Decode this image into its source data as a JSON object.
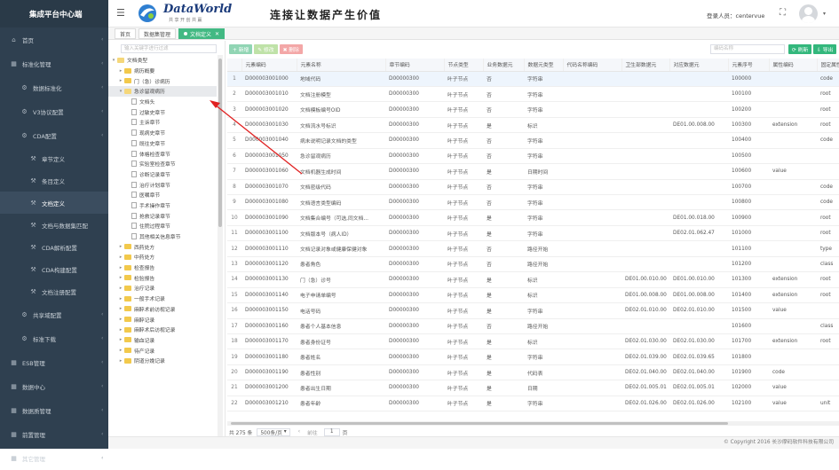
{
  "app": {
    "title": "集成平台中心端"
  },
  "sidebar": {
    "items": [
      {
        "label": "首页",
        "icon": "home-icon",
        "level": 1
      },
      {
        "label": "标准化管理",
        "icon": "grid-icon",
        "level": 1
      },
      {
        "label": "数据标准化",
        "icon": "gear-icon",
        "level": 2
      },
      {
        "label": "V3协议配置",
        "icon": "gear-icon",
        "level": 2
      },
      {
        "label": "CDA配置",
        "icon": "gear-icon",
        "level": 2
      },
      {
        "label": "章节定义",
        "icon": "wrench-icon",
        "level": 3
      },
      {
        "label": "条目定义",
        "icon": "wrench-icon",
        "level": 3
      },
      {
        "label": "文档定义",
        "icon": "wrench-icon",
        "level": 3,
        "selected": true
      },
      {
        "label": "文档与数据集匹配",
        "icon": "wrench-icon",
        "level": 3
      },
      {
        "label": "CDA解析配置",
        "icon": "wrench-icon",
        "level": 3
      },
      {
        "label": "CDA构建配置",
        "icon": "wrench-icon",
        "level": 3
      },
      {
        "label": "文档注册配置",
        "icon": "wrench-icon",
        "level": 3
      },
      {
        "label": "共享域配置",
        "icon": "gear-icon",
        "level": 2
      },
      {
        "label": "标准下载",
        "icon": "gear-icon",
        "level": 2
      },
      {
        "label": "ESB管理",
        "icon": "grid-icon",
        "level": 1
      },
      {
        "label": "数据中心",
        "icon": "grid-icon",
        "level": 1
      },
      {
        "label": "数据质管理",
        "icon": "grid-icon",
        "level": 1
      },
      {
        "label": "前置管理",
        "icon": "grid-icon",
        "level": 1
      },
      {
        "label": "其它管理",
        "icon": "grid-icon",
        "level": 1
      }
    ]
  },
  "header": {
    "logo_text": "DataWorld",
    "logo_sub": "共享开创共赢",
    "slogan": "连接让数据产生价值",
    "user_label": "登录人员：centervue"
  },
  "tabs": [
    {
      "label": "首页",
      "active": false
    },
    {
      "label": "数据集管理",
      "active": false
    },
    {
      "label": "文档定义",
      "active": true
    }
  ],
  "tree": {
    "search_placeholder": "输入关键字进行过滤",
    "nodes": [
      {
        "label": "文档类型",
        "depth": 0,
        "toggle": "▾",
        "type": "folder-open"
      },
      {
        "label": "病历概要",
        "depth": 1,
        "toggle": "▸",
        "type": "folder"
      },
      {
        "label": "门（急）诊病历",
        "depth": 1,
        "toggle": "▸",
        "type": "folder"
      },
      {
        "label": "急诊留观病历",
        "depth": 1,
        "toggle": "▾",
        "type": "folder-open",
        "highlight": true
      },
      {
        "label": "文档头",
        "depth": 2,
        "type": "file"
      },
      {
        "label": "过敏史章节",
        "depth": 2,
        "type": "file"
      },
      {
        "label": "主诉章节",
        "depth": 2,
        "type": "file"
      },
      {
        "label": "现病史章节",
        "depth": 2,
        "type": "file"
      },
      {
        "label": "既往史章节",
        "depth": 2,
        "type": "file"
      },
      {
        "label": "体格检查章节",
        "depth": 2,
        "type": "file"
      },
      {
        "label": "实验室检查章节",
        "depth": 2,
        "type": "file"
      },
      {
        "label": "诊断记录章节",
        "depth": 2,
        "type": "file"
      },
      {
        "label": "治疗计划章节",
        "depth": 2,
        "type": "file"
      },
      {
        "label": "医嘱章节",
        "depth": 2,
        "type": "file"
      },
      {
        "label": "手术操作章节",
        "depth": 2,
        "type": "file"
      },
      {
        "label": "抢救记录章节",
        "depth": 2,
        "type": "file"
      },
      {
        "label": "住院过程章节",
        "depth": 2,
        "type": "file"
      },
      {
        "label": "其他相关信息章节",
        "depth": 2,
        "type": "file"
      },
      {
        "label": "西药处方",
        "depth": 1,
        "toggle": "▸",
        "type": "folder"
      },
      {
        "label": "中药处方",
        "depth": 1,
        "toggle": "▸",
        "type": "folder"
      },
      {
        "label": "检查报告",
        "depth": 1,
        "toggle": "▸",
        "type": "folder"
      },
      {
        "label": "检验报告",
        "depth": 1,
        "toggle": "▸",
        "type": "folder"
      },
      {
        "label": "治疗记录",
        "depth": 1,
        "toggle": "▸",
        "type": "folder"
      },
      {
        "label": "一般手术记录",
        "depth": 1,
        "toggle": "▸",
        "type": "folder"
      },
      {
        "label": "麻醉术前访视记录",
        "depth": 1,
        "toggle": "▸",
        "type": "folder"
      },
      {
        "label": "麻醉记录",
        "depth": 1,
        "toggle": "▸",
        "type": "folder"
      },
      {
        "label": "麻醉术后访视记录",
        "depth": 1,
        "toggle": "▸",
        "type": "folder"
      },
      {
        "label": "输血记录",
        "depth": 1,
        "toggle": "▸",
        "type": "folder"
      },
      {
        "label": "待产记录",
        "depth": 1,
        "toggle": "▸",
        "type": "folder"
      },
      {
        "label": "阴道分娩记录",
        "depth": 1,
        "toggle": "▸",
        "type": "folder"
      }
    ]
  },
  "toolbar": {
    "add_label": "+ 新增",
    "edit_label": "✎ 修改",
    "delete_label": "✖ 删除",
    "search_placeholder": "编码名称",
    "refresh_label": "⟳ 刷新",
    "export_label": "⇩ 导出"
  },
  "table": {
    "columns": [
      "",
      "元素编码",
      "元素名称",
      "章节编码",
      "节点类型",
      "业务数据元",
      "数据元类型",
      "代码名称编码",
      "卫生部数据元",
      "对应数据元",
      "元素序号",
      "属性编码",
      "固定属性"
    ],
    "rows": [
      [
        "1",
        "D000003001000",
        "地域代码",
        "D00000300",
        "叶子节点",
        "否",
        "字符串",
        "",
        "",
        "",
        "100000",
        "",
        "code"
      ],
      [
        "2",
        "D000003001010",
        "文档注册模型",
        "D00000300",
        "叶子节点",
        "否",
        "字符串",
        "",
        "",
        "",
        "100100",
        "",
        "root"
      ],
      [
        "3",
        "D000003001020",
        "文档模板编号OID",
        "D00000300",
        "叶子节点",
        "否",
        "字符串",
        "",
        "",
        "",
        "100200",
        "",
        "root"
      ],
      [
        "4",
        "D000003001030",
        "文档流水号标识",
        "D00000300",
        "叶子节点",
        "是",
        "标识",
        "",
        "",
        "DE01.00.008.00",
        "100300",
        "extension",
        "root"
      ],
      [
        "5",
        "D000003001040",
        "病未说明记录文档的类型",
        "D00000300",
        "叶子节点",
        "否",
        "字符串",
        "",
        "",
        "",
        "100400",
        "",
        "code"
      ],
      [
        "6",
        "D000003001050",
        "急诊留观病历",
        "D00000300",
        "叶子节点",
        "否",
        "字符串",
        "",
        "",
        "",
        "100500",
        "",
        ""
      ],
      [
        "7",
        "D000003001060",
        "文档机器生成时间",
        "D00000300",
        "叶子节点",
        "是",
        "日期时间",
        "",
        "",
        "",
        "100600",
        "value",
        ""
      ],
      [
        "8",
        "D000003001070",
        "文档密级代码",
        "D00000300",
        "叶子节点",
        "否",
        "字符串",
        "",
        "",
        "",
        "100700",
        "",
        "code"
      ],
      [
        "9",
        "D000003001080",
        "文档语言类型编码",
        "D00000300",
        "叶子节点",
        "否",
        "字符串",
        "",
        "",
        "",
        "100800",
        "",
        "code"
      ],
      [
        "10",
        "D000003001090",
        "文档集合编号（可选,同文档...",
        "D00000300",
        "叶子节点",
        "是",
        "字符串",
        "",
        "",
        "DE01.00.018.00",
        "100900",
        "",
        "root"
      ],
      [
        "11",
        "D000003001100",
        "文档版本号（病人ID）",
        "D00000300",
        "叶子节点",
        "是",
        "字符串",
        "",
        "",
        "DE02.01.062.47",
        "101000",
        "",
        "root"
      ],
      [
        "12",
        "D000003001110",
        "文档记录对象或健康保健对象",
        "D00000300",
        "叶子节点",
        "否",
        "路径开始",
        "",
        "",
        "",
        "101100",
        "",
        "type"
      ],
      [
        "13",
        "D000003001120",
        "患者角色",
        "D00000300",
        "叶子节点",
        "否",
        "路径开始",
        "",
        "",
        "",
        "101200",
        "",
        "class"
      ],
      [
        "14",
        "D000003001130",
        "门（急）诊号",
        "D00000300",
        "叶子节点",
        "是",
        "标识",
        "",
        "DE01.00.010.00",
        "DE01.00.010.00",
        "101300",
        "extension",
        "root"
      ],
      [
        "15",
        "D000003001140",
        "电子申请单编号",
        "D00000300",
        "叶子节点",
        "是",
        "标识",
        "",
        "DE01.00.008.00",
        "DE01.00.008.00",
        "101400",
        "extension",
        "root"
      ],
      [
        "16",
        "D000003001150",
        "电话号码",
        "D00000300",
        "叶子节点",
        "是",
        "字符串",
        "",
        "DE02.01.010.00",
        "DE02.01.010.00",
        "101500",
        "value",
        ""
      ],
      [
        "17",
        "D000003001160",
        "患者个人基本信息",
        "D00000300",
        "叶子节点",
        "否",
        "路径开始",
        "",
        "",
        "",
        "101600",
        "",
        "class"
      ],
      [
        "18",
        "D000003001170",
        "患者身份证号",
        "D00000300",
        "叶子节点",
        "是",
        "标识",
        "",
        "DE02.01.030.00",
        "DE02.01.030.00",
        "101700",
        "extension",
        "root"
      ],
      [
        "19",
        "D000003001180",
        "患者姓名",
        "D00000300",
        "叶子节点",
        "是",
        "字符串",
        "",
        "DE02.01.039.00",
        "DE02.01.039.65",
        "101800",
        "",
        ""
      ],
      [
        "20",
        "D000003001190",
        "患者性别",
        "D00000300",
        "叶子节点",
        "是",
        "代码表",
        "",
        "DE02.01.040.00",
        "DE02.01.040.00",
        "101900",
        "code",
        ""
      ],
      [
        "21",
        "D000003001200",
        "患者出生日期",
        "D00000300",
        "叶子节点",
        "是",
        "日期",
        "",
        "DE02.01.005.01",
        "DE02.01.005.01",
        "102000",
        "value",
        ""
      ],
      [
        "22",
        "D000003001210",
        "患者年龄",
        "D00000300",
        "叶子节点",
        "是",
        "字符串",
        "",
        "DE02.01.026.00",
        "DE02.01.026.00",
        "102100",
        "value",
        "unit"
      ]
    ]
  },
  "pager": {
    "total": "共 275 条",
    "page_size": "500条/页",
    "prev": "‹",
    "goto_label": "前往",
    "page": "1",
    "page_suffix": "页"
  },
  "footer": {
    "copyright": "© Copyright 2016 长沙摩码软件科技有限公司"
  },
  "colors": {
    "sidebar": "#2f4050",
    "accent": "#42b983",
    "annotation_arrow": "#e02020"
  }
}
